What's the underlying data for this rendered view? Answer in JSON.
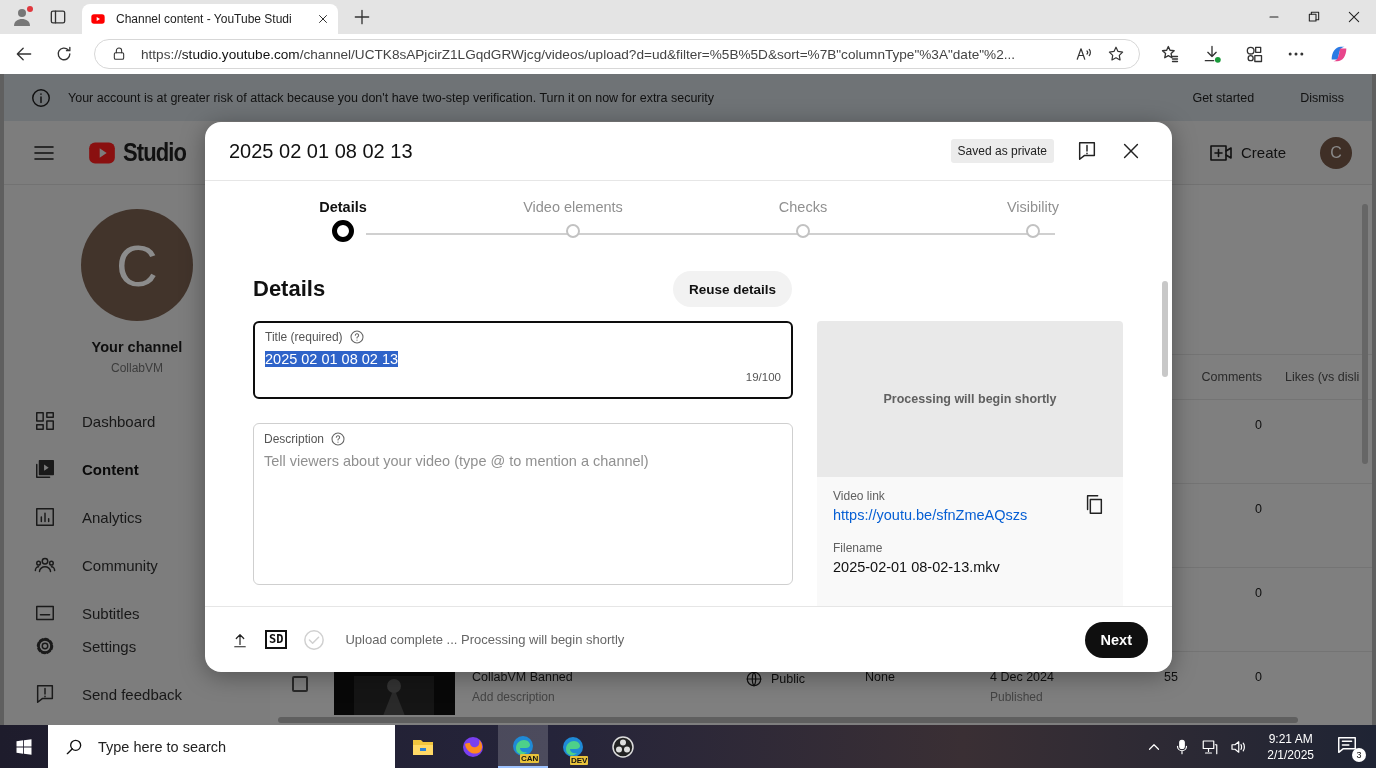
{
  "browser": {
    "tab_title": "Channel content - YouTube Studi",
    "address": "https://studio.youtube.com/channel/UCTK8sAPjcirZ1LGqdGRWjcg/videos/upload?d=ud&filter=%5B%5D&sort=%7B\"columnType\"%3A\"date\"%2..."
  },
  "banner": {
    "message": "Your account is at greater risk of attack because you don't have two-step verification. Turn it on now for extra security",
    "actions": [
      "Get started",
      "Dismiss"
    ]
  },
  "header": {
    "logo": "Studio",
    "create": "Create",
    "avatar": "C"
  },
  "sidebar": {
    "avatar": "C",
    "channel_label": "Your channel",
    "channel_name": "CollabVM",
    "items": [
      {
        "label": "Dashboard",
        "kind": "dashboard",
        "selected": false
      },
      {
        "label": "Content",
        "kind": "content",
        "selected": true
      },
      {
        "label": "Analytics",
        "kind": "analytics",
        "selected": false
      },
      {
        "label": "Community",
        "kind": "community",
        "selected": false
      },
      {
        "label": "Subtitles",
        "kind": "subtitles",
        "selected": false
      }
    ],
    "footer_items": [
      {
        "label": "Settings",
        "kind": "settings"
      },
      {
        "label": "Send feedback",
        "kind": "feedback"
      }
    ]
  },
  "table": {
    "columns": [
      "Comments",
      "Likes (vs disli"
    ],
    "rows": [
      {
        "comments": "0"
      },
      {
        "comments": "0"
      },
      {
        "comments": "0"
      },
      {
        "checked": false,
        "title": "CollabVM Banned",
        "description": "Add description",
        "visibility": "Public",
        "column_4": "None",
        "date": "4 Dec 2024",
        "date_status": "Published",
        "column_6": "55",
        "comments": "0"
      }
    ]
  },
  "dialog": {
    "title": "2025 02 01 08 02 13",
    "saved_badge": "Saved as private",
    "steps": [
      {
        "label": "Details",
        "selected": true
      },
      {
        "label": "Video elements",
        "selected": false
      },
      {
        "label": "Checks",
        "selected": false
      },
      {
        "label": "Visibility",
        "selected": false
      }
    ],
    "section_title": "Details",
    "reuse_button": "Reuse details",
    "title_field": {
      "label": "Title (required)",
      "value": "2025 02 01 08 02 13",
      "selected": true,
      "counter": "19/100"
    },
    "description_field": {
      "label": "Description",
      "placeholder": "Tell viewers about your video (type @ to mention a channel)"
    },
    "preview": {
      "message": "Processing will begin shortly"
    },
    "video_link": {
      "label": "Video link",
      "url": "https://youtu.be/sfnZmeAQszs"
    },
    "filename": {
      "label": "Filename",
      "value": "2025-02-01 08-02-13.mkv"
    },
    "footer": {
      "quality_badge": "SD",
      "status": "Upload complete ... Processing will begin shortly",
      "next": "Next"
    }
  },
  "taskbar": {
    "search_placeholder": "Type here to search",
    "apps": [
      {
        "kind": "files",
        "selected": false
      },
      {
        "kind": "firefox",
        "selected": false
      },
      {
        "kind": "edge",
        "badge": "CAN",
        "selected": true
      },
      {
        "kind": "edge",
        "badge": "DEV",
        "selected": false
      },
      {
        "kind": "obs",
        "selected": false
      }
    ],
    "time": "9:21 AM",
    "date": "2/1/2025",
    "notifications": "3"
  }
}
